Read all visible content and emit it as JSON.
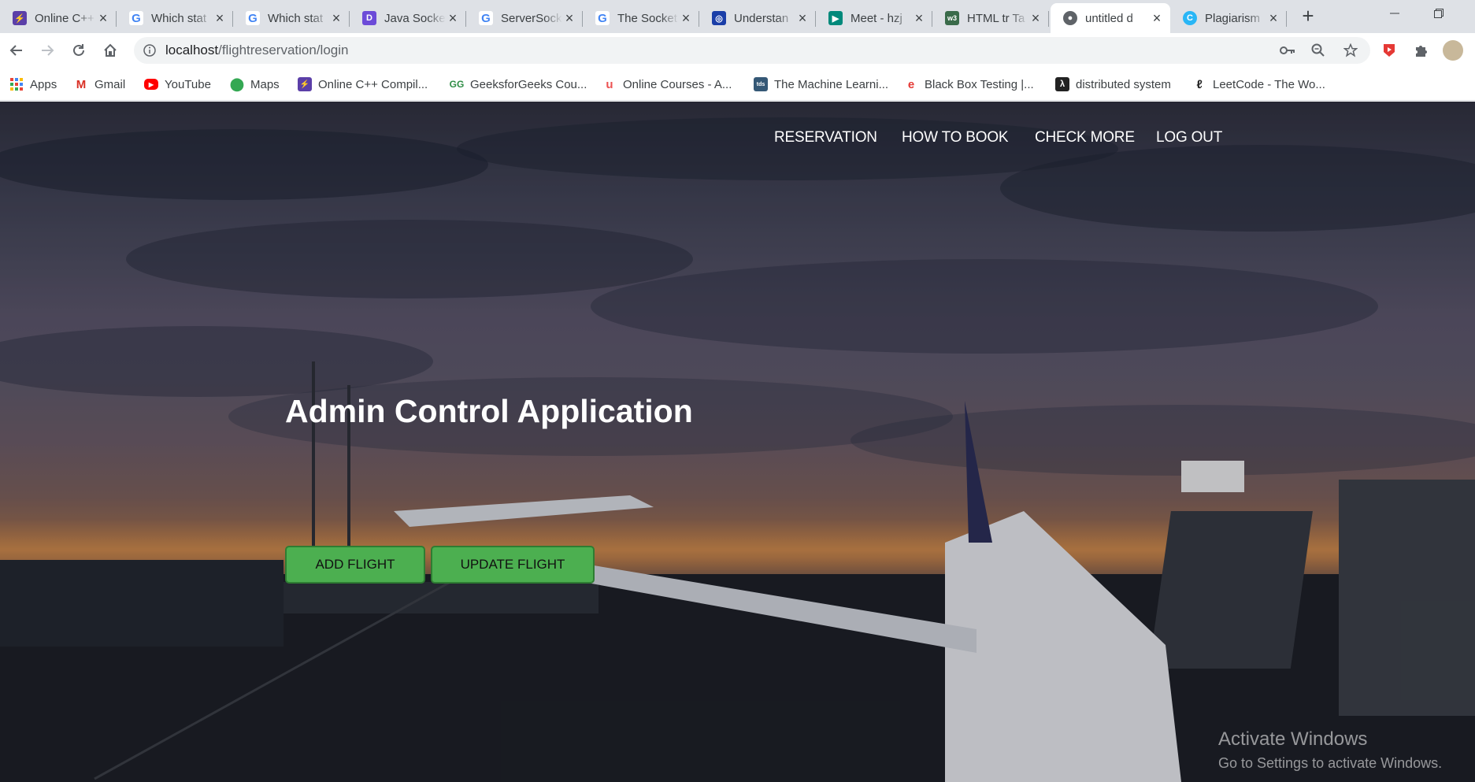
{
  "browser": {
    "tabs": [
      {
        "title": "Online C++",
        "favicon": "lightning-icon",
        "color": "#5b3fa8"
      },
      {
        "title": "Which stat",
        "favicon": "google-g-icon",
        "color": "#4285f4"
      },
      {
        "title": "Which stat",
        "favicon": "google-g-icon",
        "color": "#4285f4"
      },
      {
        "title": "Java Socket",
        "favicon": "d-logo-icon",
        "color": "#6c4bd8"
      },
      {
        "title": "ServerSock",
        "favicon": "google-g-icon",
        "color": "#4285f4"
      },
      {
        "title": "The Socket",
        "favicon": "google-g-icon",
        "color": "#4285f4"
      },
      {
        "title": "Understan",
        "favicon": "target-icon",
        "color": "#1a3ea8"
      },
      {
        "title": "Meet - hzj",
        "favicon": "meet-icon",
        "color": "#00897b"
      },
      {
        "title": "HTML tr Ta",
        "favicon": "w3-icon",
        "color": "#3a6b4a"
      },
      {
        "title": "untitled d",
        "favicon": "globe-icon",
        "color": "#5f6368",
        "active": true
      },
      {
        "title": "Plagiarism",
        "favicon": "c-logo-icon",
        "color": "#29b6f6"
      }
    ],
    "new_tab_label": "+",
    "address": {
      "host": "localhost",
      "path": "/flightreservation/login"
    }
  },
  "bookmarks": [
    {
      "label": "Apps",
      "icon": "apps-grid-icon",
      "color": "#ea4335"
    },
    {
      "label": "Gmail",
      "icon": "gmail-icon",
      "color": "#d93025"
    },
    {
      "label": "YouTube",
      "icon": "youtube-icon",
      "color": "#ff0000"
    },
    {
      "label": "Maps",
      "icon": "maps-pin-icon",
      "color": "#34a853"
    },
    {
      "label": "Online C++ Compil...",
      "icon": "lightning-icon",
      "color": "#5b3fa8"
    },
    {
      "label": "GeeksforGeeks Cou...",
      "icon": "gfg-icon",
      "color": "#2f8d46"
    },
    {
      "label": "Online Courses - A...",
      "icon": "udemy-icon",
      "color": "#ec5252"
    },
    {
      "label": "The Machine Learni...",
      "icon": "tds-icon",
      "color": "#355876"
    },
    {
      "label": "Black Box Testing |...",
      "icon": "e-logo-icon",
      "color": "#e53935"
    },
    {
      "label": "distributed system",
      "icon": "lambda-icon",
      "color": "#222222"
    },
    {
      "label": "LeetCode - The Wo...",
      "icon": "leetcode-icon",
      "color": "#ffa116"
    }
  ],
  "site": {
    "nav": [
      "RESERVATION",
      "HOW TO BOOK",
      "CHECK MORE",
      "LOG OUT"
    ],
    "hero_title": "Admin Control Application",
    "buttons": {
      "add": "ADD FLIGHT",
      "update": "UPDATE FLIGHT"
    },
    "accent": "#4caf50"
  },
  "os_watermark": {
    "line1": "Activate Windows",
    "line2": "Go to Settings to activate Windows."
  }
}
